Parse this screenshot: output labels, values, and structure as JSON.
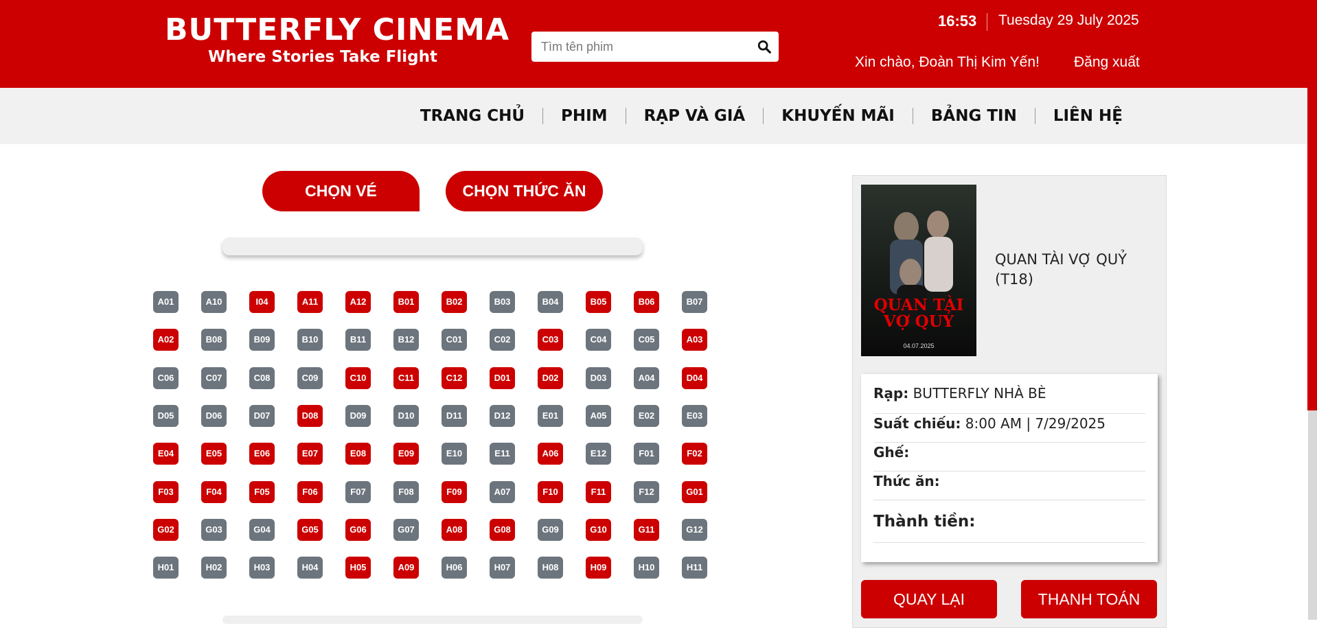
{
  "header": {
    "brand": "BUTTERFLY CINEMA",
    "tagline": "Where Stories Take Flight",
    "search_placeholder": "Tìm tên phim",
    "time": "16:53",
    "date": "Tuesday 29 July 2025",
    "greeting": "Xin chào, Đoàn Thị Kim Yến!",
    "logout": "Đăng xuất"
  },
  "nav": [
    "TRANG CHỦ",
    "PHIM",
    "RẠP VÀ GIÁ",
    "KHUYẾN MÃI",
    "BẢNG TIN",
    "LIÊN HỆ"
  ],
  "tabs": {
    "tickets": "CHỌN VÉ",
    "food": "CHỌN THỨC ĂN"
  },
  "seat_rows": [
    [
      [
        "A01",
        0
      ],
      [
        "A10",
        0
      ],
      [
        "I04",
        1
      ],
      [
        "A11",
        1
      ],
      [
        "A12",
        1
      ],
      [
        "B01",
        1
      ],
      [
        "B02",
        1
      ],
      [
        "B03",
        0
      ],
      [
        "B04",
        0
      ],
      [
        "B05",
        1
      ],
      [
        "B06",
        1
      ],
      [
        "B07",
        0
      ]
    ],
    [
      [
        "A02",
        1
      ],
      [
        "B08",
        0
      ],
      [
        "B09",
        0
      ],
      [
        "B10",
        0
      ],
      [
        "B11",
        0
      ],
      [
        "B12",
        0
      ],
      [
        "C01",
        0
      ],
      [
        "C02",
        0
      ],
      [
        "C03",
        1
      ],
      [
        "C04",
        0
      ],
      [
        "C05",
        0
      ],
      [
        "A03",
        1
      ]
    ],
    [
      [
        "C06",
        0
      ],
      [
        "C07",
        0
      ],
      [
        "C08",
        0
      ],
      [
        "C09",
        0
      ],
      [
        "C10",
        1
      ],
      [
        "C11",
        1
      ],
      [
        "C12",
        1
      ],
      [
        "D01",
        1
      ],
      [
        "D02",
        1
      ],
      [
        "D03",
        0
      ],
      [
        "A04",
        0
      ],
      [
        "D04",
        1
      ]
    ],
    [
      [
        "D05",
        0
      ],
      [
        "D06",
        0
      ],
      [
        "D07",
        0
      ],
      [
        "D08",
        1
      ],
      [
        "D09",
        0
      ],
      [
        "D10",
        0
      ],
      [
        "D11",
        0
      ],
      [
        "D12",
        0
      ],
      [
        "E01",
        0
      ],
      [
        "A05",
        0
      ],
      [
        "E02",
        0
      ],
      [
        "E03",
        0
      ]
    ],
    [
      [
        "E04",
        1
      ],
      [
        "E05",
        1
      ],
      [
        "E06",
        1
      ],
      [
        "E07",
        1
      ],
      [
        "E08",
        1
      ],
      [
        "E09",
        1
      ],
      [
        "E10",
        0
      ],
      [
        "E11",
        0
      ],
      [
        "A06",
        1
      ],
      [
        "E12",
        0
      ],
      [
        "F01",
        0
      ],
      [
        "F02",
        1
      ]
    ],
    [
      [
        "F03",
        1
      ],
      [
        "F04",
        1
      ],
      [
        "F05",
        1
      ],
      [
        "F06",
        1
      ],
      [
        "F07",
        0
      ],
      [
        "F08",
        0
      ],
      [
        "F09",
        1
      ],
      [
        "A07",
        0
      ],
      [
        "F10",
        1
      ],
      [
        "F11",
        1
      ],
      [
        "F12",
        0
      ],
      [
        "G01",
        1
      ]
    ],
    [
      [
        "G02",
        1
      ],
      [
        "G03",
        0
      ],
      [
        "G04",
        0
      ],
      [
        "G05",
        1
      ],
      [
        "G06",
        1
      ],
      [
        "G07",
        0
      ],
      [
        "A08",
        1
      ],
      [
        "G08",
        1
      ],
      [
        "G09",
        0
      ],
      [
        "G10",
        1
      ],
      [
        "G11",
        1
      ],
      [
        "G12",
        0
      ]
    ],
    [
      [
        "H01",
        0
      ],
      [
        "H02",
        0
      ],
      [
        "H03",
        0
      ],
      [
        "H04",
        0
      ],
      [
        "H05",
        1
      ],
      [
        "A09",
        1
      ],
      [
        "H06",
        0
      ],
      [
        "H07",
        0
      ],
      [
        "H08",
        0
      ],
      [
        "H09",
        1
      ],
      [
        "H10",
        0
      ],
      [
        "H11",
        0
      ]
    ]
  ],
  "movie": {
    "title": "QUAN TÀI VỢ QUỶ (T18)",
    "poster_text": "QUAN TÀI VỢ QUỶ",
    "poster_date": "04.07.2025"
  },
  "booking": {
    "cinema_label": "Rạp:",
    "cinema_value": "BUTTERFLY NHÀ BÈ",
    "showtime_label": "Suất chiếu:",
    "showtime_value": "8:00 AM | 7/29/2025",
    "seat_label": "Ghế:",
    "seat_value": "",
    "food_label": "Thức ăn:",
    "food_value": "",
    "total_label": "Thành tiền:",
    "total_value": ""
  },
  "buttons": {
    "back": "QUAY LẠI",
    "pay": "THANH TOÁN"
  },
  "colors": {
    "primary": "#cc0000",
    "seat_available": "#6c757d",
    "seat_taken": "#cc0000"
  }
}
